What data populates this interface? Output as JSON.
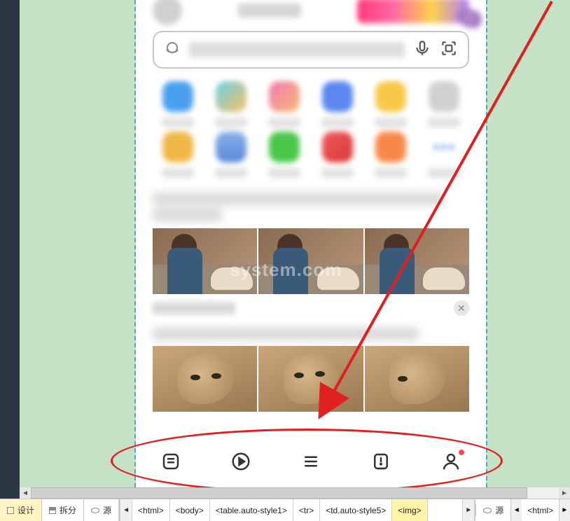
{
  "watermark": "system.com",
  "app_icon_colors": [
    [
      "#4aa0ee",
      "linear-gradient(135deg,#6ad0e0,#f8c06a)",
      "linear-gradient(135deg,#f07ab0,#f8b878)",
      "#5a88f0",
      "#f8c848",
      "#d0d0d0"
    ],
    [
      "#f0b848",
      "linear-gradient(180deg,#88b0e8,#5a88d8)",
      "#4ac84a",
      "linear-gradient(135deg,#f05858,#d83838)",
      "#f88848",
      "more"
    ]
  ],
  "bottom_tabs": {
    "design": "设计",
    "split": "拆分",
    "source": "源"
  },
  "breadcrumb": [
    "<html>",
    "<body>",
    "<table.auto-style1>",
    "<tr>",
    "<td.auto-style5>",
    "<img>"
  ],
  "breadcrumb_selected_index": 5,
  "right_source_tab": "源",
  "right_crumb": "<html>",
  "nav_icons": [
    "feed-icon",
    "video-icon",
    "menu-icon",
    "notify-icon",
    "profile-icon"
  ]
}
